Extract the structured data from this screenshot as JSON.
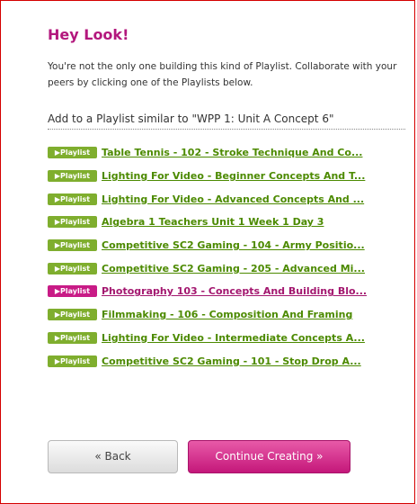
{
  "heading": "Hey Look!",
  "intro": "You're not the only one building this kind of Playlist. Collaborate with your peers by clicking one of the Playlists below.",
  "add_heading": "Add to a Playlist similar to \"WPP 1: Unit A Concept 6\"",
  "badge_label": "▶Playlist",
  "colors": {
    "heading": "#b3177d",
    "link_green": "#4c8a00",
    "badge_green": "#7fae2e",
    "badge_pink": "#c81b86",
    "accent_pink": "#c4177a",
    "border_red": "#d40000"
  },
  "playlists": [
    {
      "title": "Table Tennis - 102 - Stroke Technique And Co...",
      "highlighted": false
    },
    {
      "title": "Lighting For Video - Beginner Concepts And T...",
      "highlighted": false
    },
    {
      "title": "Lighting For Video - Advanced Concepts And ...",
      "highlighted": false
    },
    {
      "title": "Algebra 1 Teachers Unit 1 Week 1 Day 3",
      "highlighted": false
    },
    {
      "title": "Competitive SC2 Gaming - 104 - Army Positio...",
      "highlighted": false
    },
    {
      "title": "Competitive SC2 Gaming - 205 - Advanced Mi...",
      "highlighted": false
    },
    {
      "title": "Photography 103 - Concepts And Building Blo...",
      "highlighted": true
    },
    {
      "title": "Filmmaking - 106 - Composition And Framing",
      "highlighted": false
    },
    {
      "title": "Lighting For Video - Intermediate Concepts A...",
      "highlighted": false
    },
    {
      "title": "Competitive SC2 Gaming - 101 - Stop Drop A...",
      "highlighted": false
    }
  ],
  "buttons": {
    "back": "« Back",
    "continue": "Continue Creating »"
  }
}
